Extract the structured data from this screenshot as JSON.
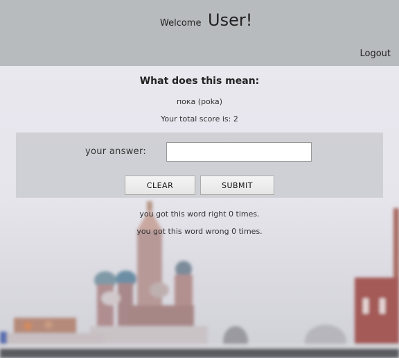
{
  "header": {
    "welcome_label": "Welcome",
    "user_label": "User!",
    "logout_label": "Logout"
  },
  "quiz": {
    "question": "What does this mean:",
    "word": "пока (poka)",
    "score_text": "Your total score is: 2",
    "answer_label": "your answer:",
    "answer_value": "",
    "answer_placeholder": "",
    "clear_label": "CLEAR",
    "submit_label": "SUBMIT",
    "right_text": "you got this word right 0 times.",
    "wrong_text": "you got this word wrong 0 times."
  },
  "colors": {
    "header_bg": "#b8bbbd",
    "panel_bg": "#cdced2"
  }
}
